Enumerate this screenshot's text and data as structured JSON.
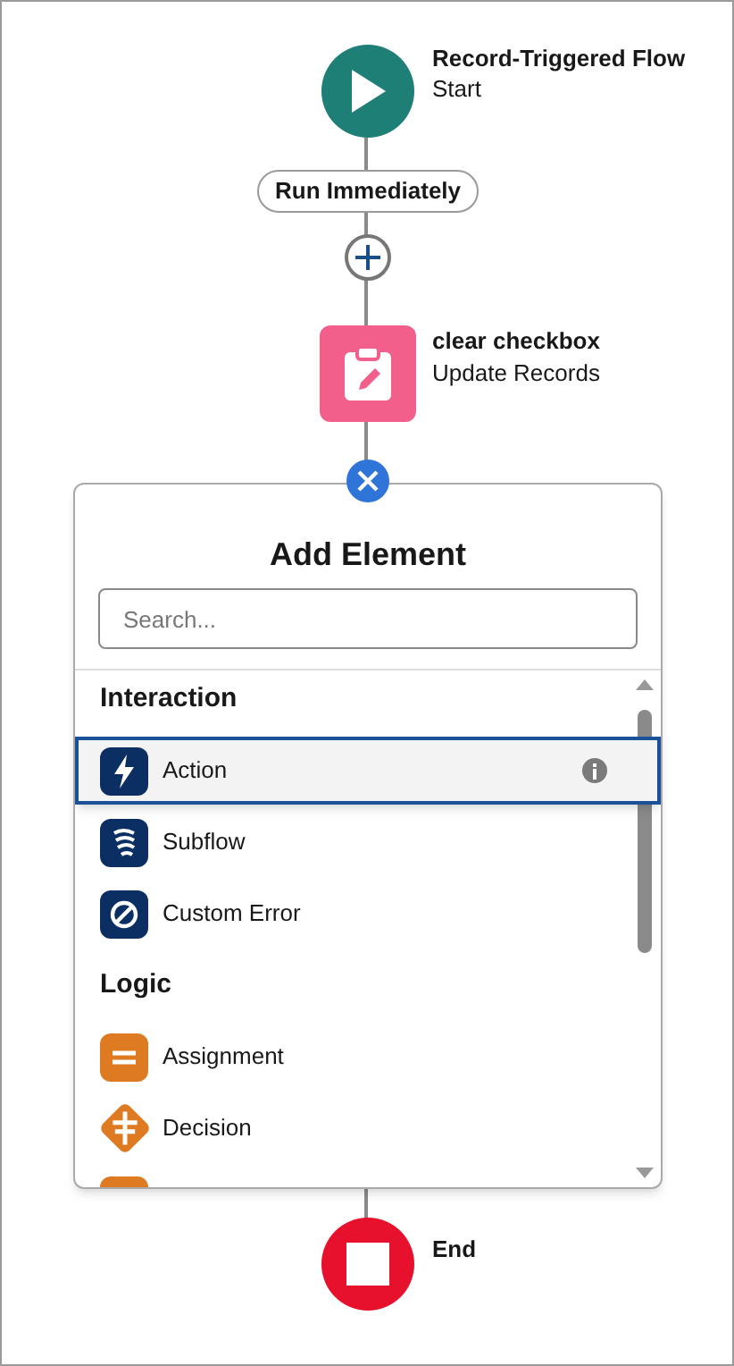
{
  "start_node": {
    "title": "Record-Triggered Flow",
    "subtitle": "Start"
  },
  "path_label": {
    "label": "Run Immediately"
  },
  "update_node": {
    "title": "clear checkbox",
    "subtitle": "Update Records"
  },
  "add_element_panel": {
    "title": "Add Element",
    "search": {
      "placeholder": "Search..."
    },
    "items": [
      {
        "kind": "category",
        "label": "Interaction"
      },
      {
        "kind": "element",
        "label": "Action",
        "color": "#0b2f63",
        "selected": true
      },
      {
        "kind": "element",
        "label": "Subflow",
        "color": "#0b2f63",
        "selected": false
      },
      {
        "kind": "element",
        "label": "Custom Error",
        "color": "#0b2f63",
        "selected": false
      },
      {
        "kind": "category",
        "label": "Logic"
      },
      {
        "kind": "element",
        "label": "Assignment",
        "color": "#dd7a22",
        "selected": false
      },
      {
        "kind": "element",
        "label": "Decision",
        "color": "#dd7a22",
        "selected": false
      },
      {
        "kind": "element",
        "color": "#dd7a22"
      }
    ]
  },
  "end_node": {
    "title": "End"
  }
}
